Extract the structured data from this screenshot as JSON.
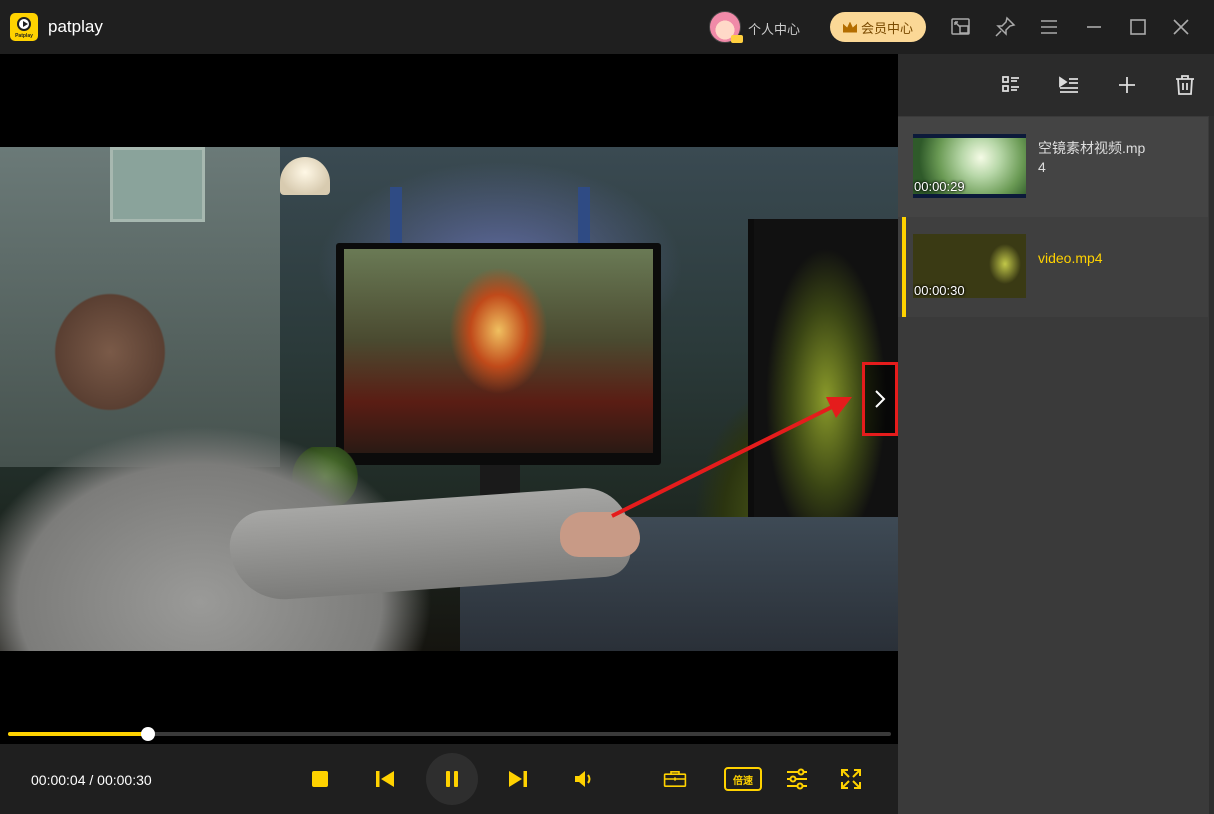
{
  "app": {
    "name": "patplay",
    "logo_text": "Patplay"
  },
  "header": {
    "user_center_label": "个人中心",
    "vip_label": "会员中心",
    "icons": [
      "mini-mode-icon",
      "pin-icon",
      "menu-icon",
      "minimize-icon",
      "maximize-icon",
      "close-icon"
    ]
  },
  "player": {
    "current_time": "00:00:04",
    "total_time": "00:00:30",
    "time_display": "00:00:04 / 00:00:30",
    "progress_fraction": 0.158,
    "speed_label": "倍速",
    "accent_color": "#ffd200",
    "highlight_color": "#e51c1c"
  },
  "playlist": {
    "toolbar_icons": [
      "list-view-icon",
      "play-list-icon",
      "add-icon",
      "delete-icon"
    ],
    "items": [
      {
        "title": "空镜素材视频.mp4",
        "duration": "00:00:29",
        "active": false
      },
      {
        "title": "video.mp4",
        "duration": "00:00:30",
        "active": true
      }
    ]
  }
}
